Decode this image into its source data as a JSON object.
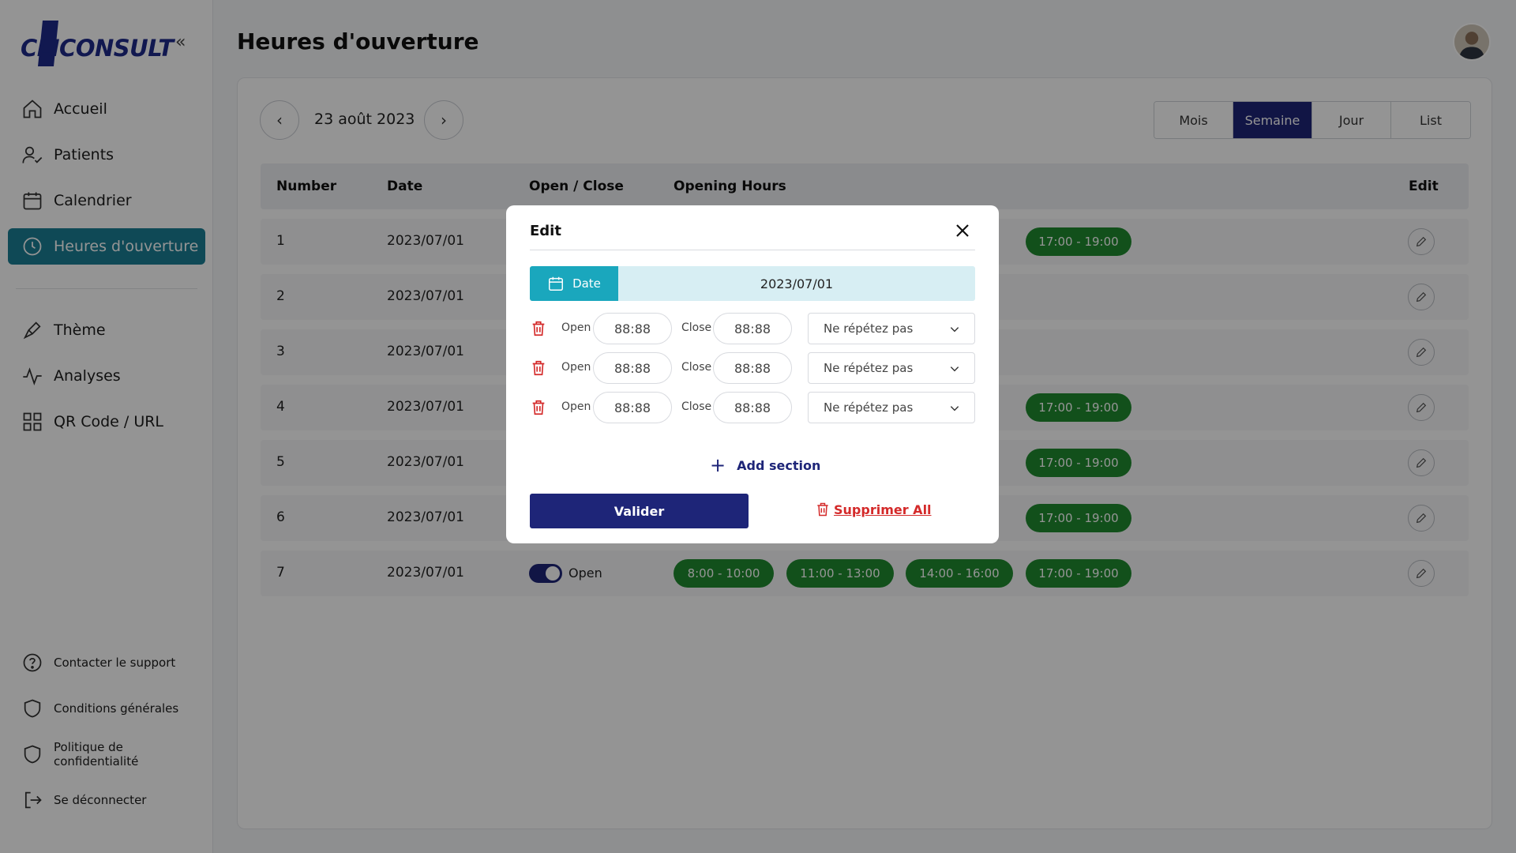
{
  "brand": {
    "logo_text": "CLICONSULT"
  },
  "sidebar": {
    "collapse_icon": "«",
    "items": [
      {
        "label": "Accueil",
        "icon": "home-icon"
      },
      {
        "label": "Patients",
        "icon": "users-icon"
      },
      {
        "label": "Calendrier",
        "icon": "calendar-icon"
      },
      {
        "label": "Heures d'ouverture",
        "icon": "clock-icon",
        "active": true
      },
      {
        "label": "Thème",
        "icon": "brush-icon"
      },
      {
        "label": "Analyses",
        "icon": "activity-icon"
      },
      {
        "label": "QR Code / URL",
        "icon": "grid-icon"
      }
    ],
    "footer": [
      {
        "label": "Contacter le support",
        "icon": "help-icon"
      },
      {
        "label": "Conditions générales",
        "icon": "shield-icon"
      },
      {
        "label": "Politique de confidentialité",
        "icon": "shield-icon"
      },
      {
        "label": "Se déconnecter",
        "icon": "logout-icon"
      }
    ]
  },
  "header": {
    "title": "Heures d'ouverture"
  },
  "toolbar": {
    "current_date": "23 août 2023",
    "views": [
      "Mois",
      "Semaine",
      "Jour",
      "List"
    ],
    "active_view": "Semaine"
  },
  "table": {
    "columns": [
      "Number",
      "Date",
      "Open / Close",
      "Opening Hours",
      "Edit"
    ],
    "rows": [
      {
        "number": "1",
        "date": "2023/07/01",
        "hours": [
          "17:00 - 19:00"
        ]
      },
      {
        "number": "2",
        "date": "2023/07/01",
        "hours": []
      },
      {
        "number": "3",
        "date": "2023/07/01",
        "hours": []
      },
      {
        "number": "4",
        "date": "2023/07/01",
        "hours": [
          "17:00 - 19:00"
        ]
      },
      {
        "number": "5",
        "date": "2023/07/01",
        "hours": [
          "17:00 - 19:00"
        ]
      },
      {
        "number": "6",
        "date": "2023/07/01",
        "hours": [
          "17:00 - 19:00"
        ]
      },
      {
        "number": "7",
        "date": "2023/07/01",
        "status": "Open",
        "hours": [
          "8:00 - 10:00",
          "11:00 - 13:00",
          "14:00 - 16:00",
          "17:00 - 19:00"
        ]
      }
    ]
  },
  "modal": {
    "title": "Edit",
    "date_tag": "Date",
    "date_value": "2023/07/01",
    "slots": [
      {
        "open_label": "Open",
        "open_value": "88:88",
        "close_label": "Close",
        "close_value": "88:88",
        "repeat": "Ne répétez pas"
      },
      {
        "open_label": "Open",
        "open_value": "88:88",
        "close_label": "Close",
        "close_value": "88:88",
        "repeat": "Ne répétez pas"
      },
      {
        "open_label": "Open",
        "open_value": "88:88",
        "close_label": "Close",
        "close_value": "88:88",
        "repeat": "Ne répétez pas"
      }
    ],
    "add_section": "Add section",
    "submit": "Valider",
    "delete_all": "Supprimer All"
  },
  "colors": {
    "primary": "#1e2578",
    "active_nav": "#1a7f95",
    "pill": "#1f8a2f",
    "date_tag": "#1aa7bd",
    "danger": "#d42a2a"
  }
}
